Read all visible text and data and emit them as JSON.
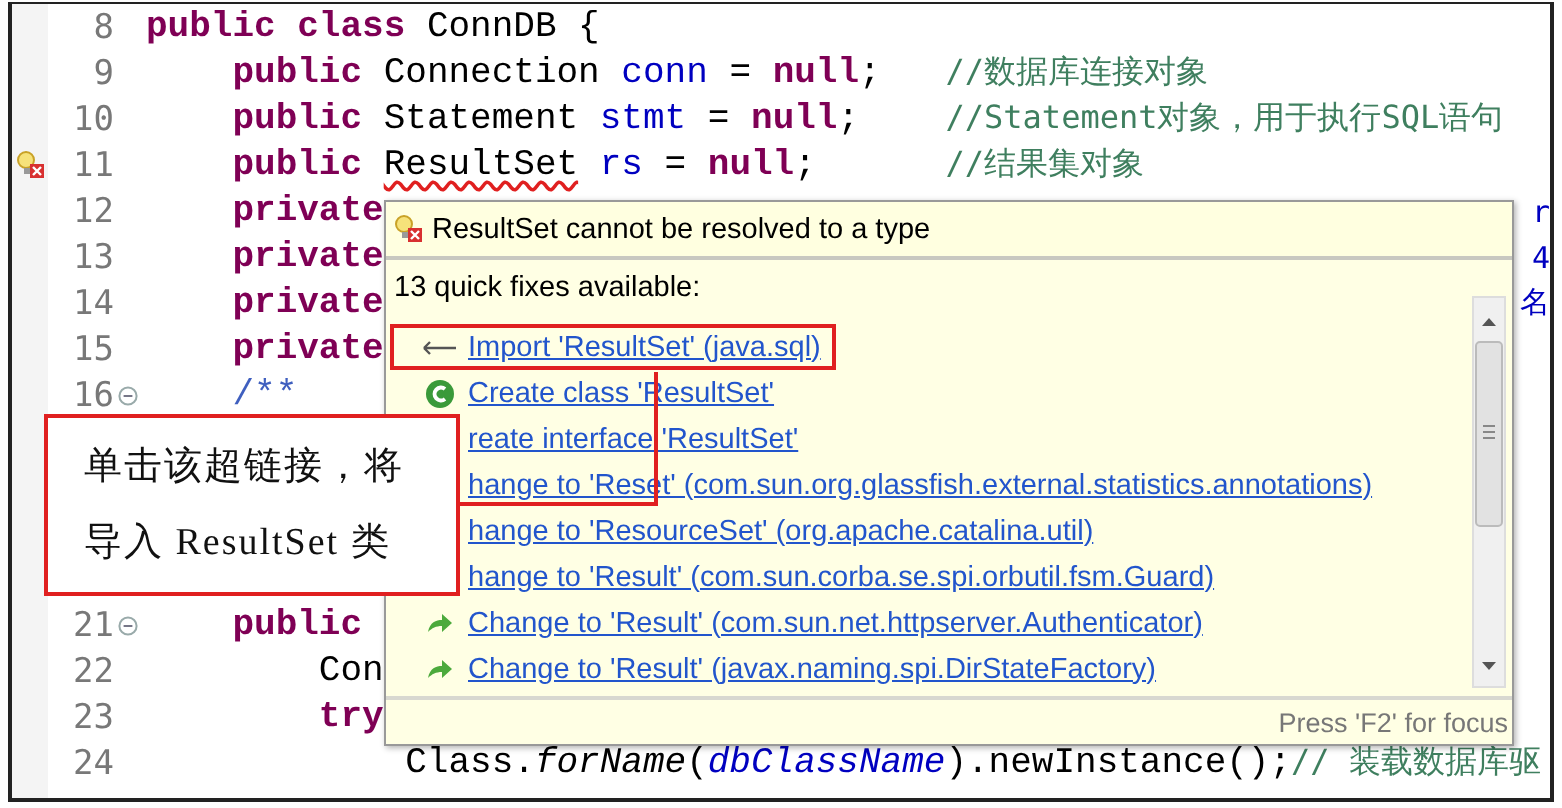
{
  "editor": {
    "lines": [
      {
        "number": "8",
        "fold": false,
        "marker": false,
        "segments": [
          {
            "kind": "keyword",
            "text": "public class"
          },
          {
            "kind": "plain",
            "text": " ConnDB {"
          }
        ]
      },
      {
        "number": "9",
        "fold": false,
        "marker": false,
        "segments": [
          {
            "kind": "keyword",
            "text": "    public"
          },
          {
            "kind": "plain",
            "text": " Connection "
          },
          {
            "kind": "field",
            "text": "conn"
          },
          {
            "kind": "plain",
            "text": " = "
          },
          {
            "kind": "keyword",
            "text": "null"
          },
          {
            "kind": "plain",
            "text": ";"
          },
          {
            "kind": "comment",
            "text": "   //数据库连接对象"
          }
        ]
      },
      {
        "number": "10",
        "fold": false,
        "marker": false,
        "segments": [
          {
            "kind": "keyword",
            "text": "    public"
          },
          {
            "kind": "plain",
            "text": " Statement "
          },
          {
            "kind": "field",
            "text": "stmt"
          },
          {
            "kind": "plain",
            "text": " = "
          },
          {
            "kind": "keyword",
            "text": "null"
          },
          {
            "kind": "plain",
            "text": ";"
          },
          {
            "kind": "comment",
            "text": "    //Statement对象，用于执行SQL语句"
          }
        ]
      },
      {
        "number": "11",
        "fold": false,
        "marker": true,
        "segments": [
          {
            "kind": "keyword",
            "text": "    public"
          },
          {
            "kind": "error",
            "text": " ResultSet"
          },
          {
            "kind": "field",
            "text": " rs"
          },
          {
            "kind": "plain",
            "text": " = "
          },
          {
            "kind": "keyword",
            "text": "null"
          },
          {
            "kind": "plain",
            "text": ";"
          },
          {
            "kind": "comment",
            "text": "      //结果集对象"
          }
        ]
      },
      {
        "number": "12",
        "fold": false,
        "marker": false,
        "segments": [
          {
            "kind": "keyword",
            "text": "    private"
          }
        ],
        "tail": "r"
      },
      {
        "number": "13",
        "fold": false,
        "marker": false,
        "segments": [
          {
            "kind": "keyword",
            "text": "    private"
          }
        ],
        "tail": "4"
      },
      {
        "number": "14",
        "fold": false,
        "marker": false,
        "segments": [
          {
            "kind": "keyword",
            "text": "    private"
          }
        ],
        "tail": "名"
      },
      {
        "number": "15",
        "fold": false,
        "marker": false,
        "segments": [
          {
            "kind": "keyword",
            "text": "    private"
          }
        ]
      },
      {
        "number": "16",
        "fold": true,
        "marker": false,
        "segments": [
          {
            "kind": "javadoc",
            "text": "    /**"
          }
        ]
      },
      {
        "number": "21",
        "fold": true,
        "marker": false,
        "segments": [
          {
            "kind": "keyword",
            "text": "    public"
          }
        ]
      },
      {
        "number": "22",
        "fold": false,
        "marker": false,
        "segments": [
          {
            "kind": "plain",
            "text": "        Con"
          }
        ]
      },
      {
        "number": "23",
        "fold": false,
        "marker": false,
        "segments": [
          {
            "kind": "keyword",
            "text": "        try"
          }
        ]
      },
      {
        "number": "24",
        "fold": false,
        "marker": false,
        "segments": [
          {
            "kind": "plain",
            "text": "            Class."
          },
          {
            "kind": "static",
            "text": "forName"
          },
          {
            "kind": "plain",
            "text": "("
          },
          {
            "kind": "static-field",
            "text": "dbClassName"
          },
          {
            "kind": "plain",
            "text": ").newInstance();"
          },
          {
            "kind": "comment",
            "text": "// 装载数据库驱"
          }
        ]
      }
    ]
  },
  "quick_fix": {
    "title": "ResultSet cannot be resolved to a type",
    "count": "13 quick fixes available:",
    "footer": "Press 'F2' for focus",
    "items": [
      {
        "kind": "import",
        "text": "Import 'ResultSet' (java.sql)",
        "highlighted": true
      },
      {
        "kind": "class",
        "text": "Create class 'ResultSet'",
        "highlighted": false
      },
      {
        "kind": "interface",
        "text": "reate interface 'ResultSet'",
        "highlighted": false
      },
      {
        "kind": "change",
        "text": "hange to 'Reset' (com.sun.org.glassfish.external.statistics.annotations)",
        "highlighted": false
      },
      {
        "kind": "change",
        "text": "hange to 'ResourceSet' (org.apache.catalina.util)",
        "highlighted": false
      },
      {
        "kind": "change",
        "text": "hange to 'Result' (com.sun.corba.se.spi.orbutil.fsm.Guard)",
        "highlighted": false
      },
      {
        "kind": "change",
        "text": "Change to 'Result' (com.sun.net.httpserver.Authenticator)",
        "highlighted": false
      },
      {
        "kind": "change",
        "text": "Change to 'Result' (javax.naming.spi.DirStateFactory)",
        "highlighted": false
      }
    ]
  },
  "callout": {
    "lines": [
      "单击该超链接，将",
      "导入 ResultSet 类"
    ]
  }
}
